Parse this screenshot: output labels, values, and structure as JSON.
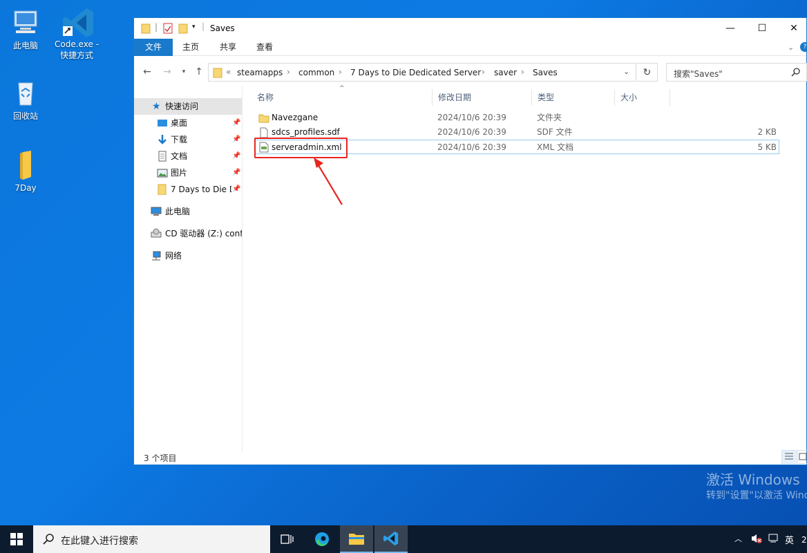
{
  "desktop": {
    "icons": [
      {
        "label": "此电脑",
        "icon": "computer-icon"
      },
      {
        "label": "Code.exe -\n快捷方式",
        "icon": "vscode-icon"
      },
      {
        "label": "回收站",
        "icon": "recycle-bin-icon"
      },
      {
        "label": "7Day",
        "icon": "folder-icon"
      }
    ],
    "watermark_line1": "激活 Windows",
    "watermark_line2": "转到\"设置\"以激活 Windows。"
  },
  "window": {
    "title": "Saves",
    "ribbon_tabs": [
      "文件",
      "主页",
      "共享",
      "查看"
    ],
    "breadcrumb": [
      "steamapps",
      "common",
      "7 Days to Die Dedicated Server",
      "saver",
      "Saves"
    ],
    "breadcrumb_overflow": "«",
    "search_placeholder": "搜索\"Saves\"",
    "sidebar": [
      {
        "label": "快速访问",
        "icon": "star-icon",
        "selected": true,
        "pinned": false
      },
      {
        "label": "桌面",
        "icon": "desktop-icon",
        "pinned": true
      },
      {
        "label": "下载",
        "icon": "download-icon",
        "pinned": true
      },
      {
        "label": "文档",
        "icon": "document-icon",
        "pinned": true
      },
      {
        "label": "图片",
        "icon": "pictures-icon",
        "pinned": true
      },
      {
        "label": "7 Days to Die D",
        "icon": "folder-icon",
        "pinned": true
      },
      {
        "label": "此电脑",
        "icon": "computer-icon"
      },
      {
        "label": "CD 驱动器 (Z:) confi",
        "icon": "cd-drive-icon"
      },
      {
        "label": "网络",
        "icon": "network-icon"
      }
    ],
    "columns": {
      "name": "名称",
      "date": "修改日期",
      "type": "类型",
      "size": "大小"
    },
    "files": [
      {
        "name": "Navezgane",
        "date": "2024/10/6 20:39",
        "type": "文件夹",
        "size": "",
        "icon": "folder-icon"
      },
      {
        "name": "sdcs_profiles.sdf",
        "date": "2024/10/6 20:39",
        "type": "SDF 文件",
        "size": "2 KB",
        "icon": "file-icon"
      },
      {
        "name": "serveradmin.xml",
        "date": "2024/10/6 20:39",
        "type": "XML 文档",
        "size": "5 KB",
        "icon": "xml-file-icon"
      }
    ],
    "status": "3 个项目"
  },
  "taskbar": {
    "search_placeholder": "在此键入进行搜索",
    "ime": "英",
    "clock_partial": "2"
  },
  "colors": {
    "accent": "#1979ca",
    "highlight": "#e8251e",
    "taskbar": "#0d1b2e"
  }
}
